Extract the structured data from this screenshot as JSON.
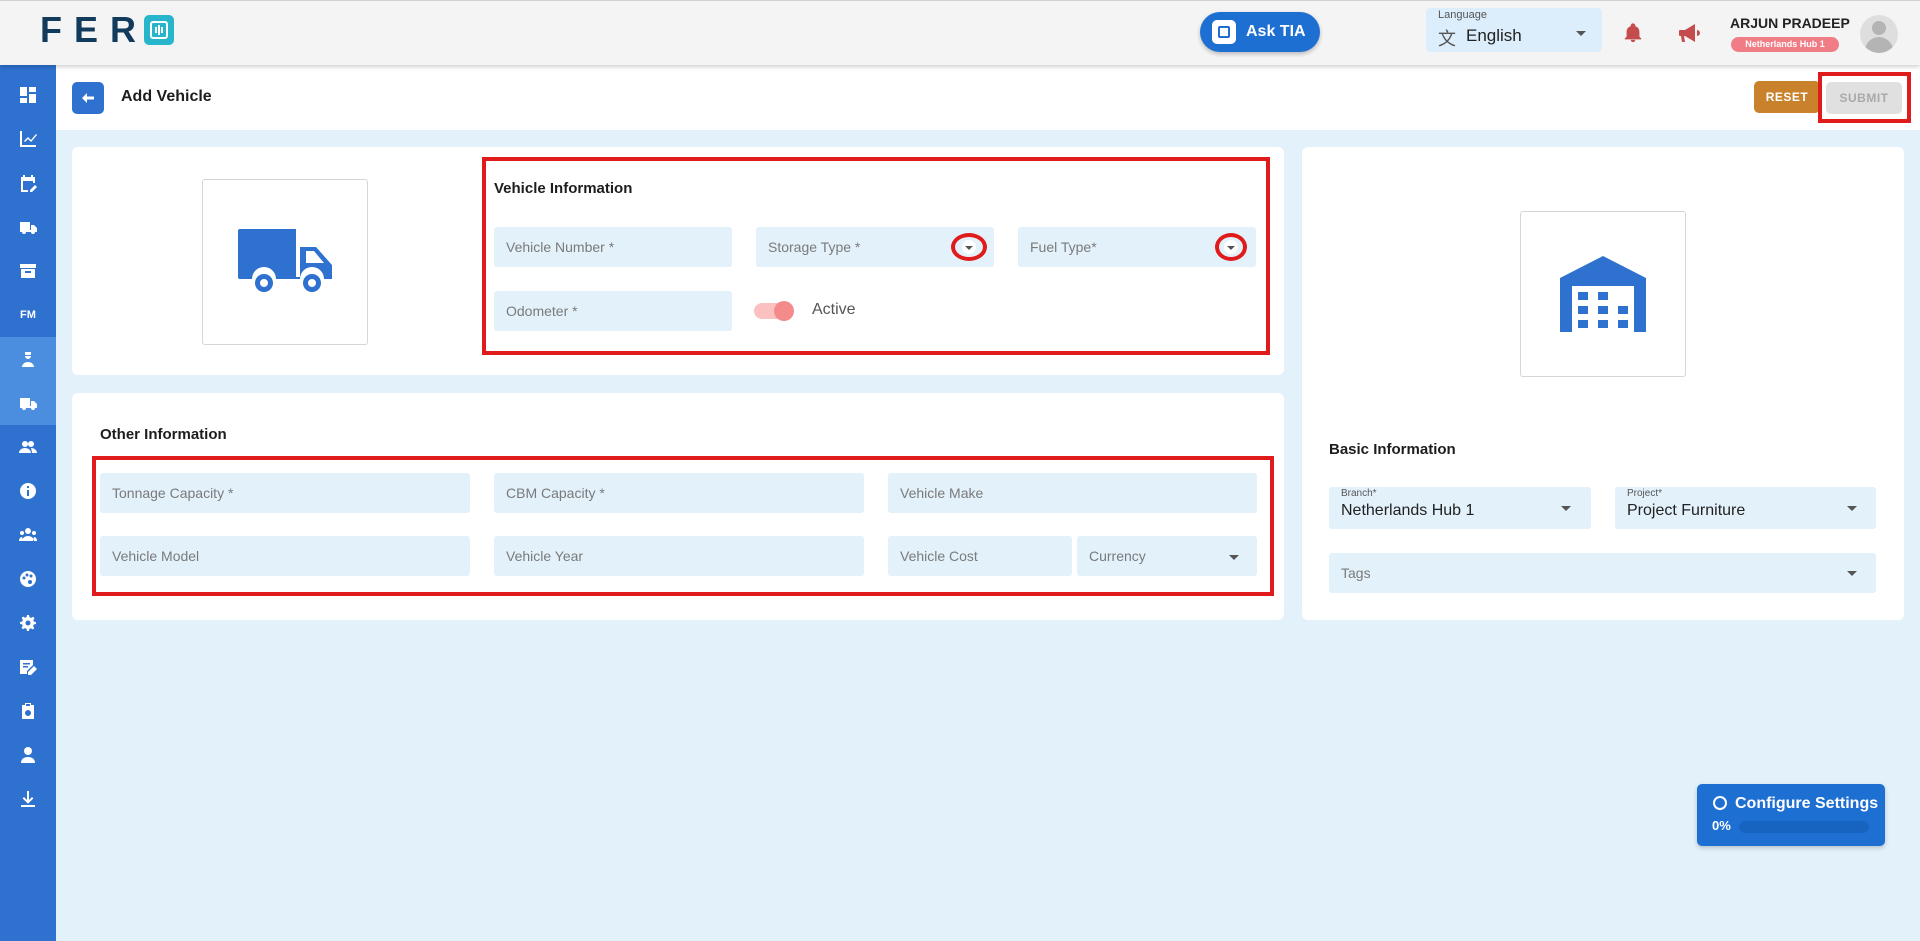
{
  "header": {
    "logo_text": "FER",
    "ask_tia_label": "Ask TIA",
    "language_label": "Language",
    "language_value": "English",
    "user_name": "ARJUN PRADEEP",
    "user_badge": "Netherlands Hub 1"
  },
  "sidebar": {
    "items": [
      {
        "icon": "dashboard-icon"
      },
      {
        "icon": "analytics-icon"
      },
      {
        "icon": "calendar-edit-icon"
      },
      {
        "icon": "delivery-truck-icon"
      },
      {
        "icon": "archive-icon"
      },
      {
        "icon": "fm-icon",
        "label": "FM"
      },
      {
        "icon": "driver-icon"
      },
      {
        "icon": "vehicle-icon"
      },
      {
        "icon": "users-icon"
      },
      {
        "icon": "info-icon"
      },
      {
        "icon": "team-icon"
      },
      {
        "icon": "palette-icon"
      },
      {
        "icon": "settings-icon"
      },
      {
        "icon": "edit-document-icon"
      },
      {
        "icon": "clipboard-icon"
      },
      {
        "icon": "user-manage-icon"
      },
      {
        "icon": "download-icon"
      }
    ]
  },
  "page": {
    "title": "Add Vehicle",
    "reset_label": "RESET",
    "submit_label": "SUBMIT"
  },
  "vehicle_info": {
    "title": "Vehicle Information",
    "vehicle_number_placeholder": "Vehicle Number *",
    "storage_type_placeholder": "Storage Type *",
    "fuel_type_placeholder": "Fuel Type*",
    "odometer_placeholder": "Odometer *",
    "active_label": "Active"
  },
  "other_info": {
    "title": "Other Information",
    "tonnage_placeholder": "Tonnage Capacity *",
    "cbm_placeholder": "CBM Capacity *",
    "make_placeholder": "Vehicle Make",
    "model_placeholder": "Vehicle Model",
    "year_placeholder": "Vehicle Year",
    "cost_placeholder": "Vehicle Cost",
    "currency_placeholder": "Currency"
  },
  "basic_info": {
    "title": "Basic Information",
    "branch_label": "Branch*",
    "branch_value": "Netherlands Hub 1",
    "project_label": "Project*",
    "project_value": "Project Furniture",
    "tags_placeholder": "Tags"
  },
  "configure": {
    "title": "Configure Settings",
    "percent": "0%",
    "progress": 0
  },
  "colors": {
    "primary": "#2e71cf",
    "reset": "#c9822b",
    "highlight": "#e01b1b"
  }
}
